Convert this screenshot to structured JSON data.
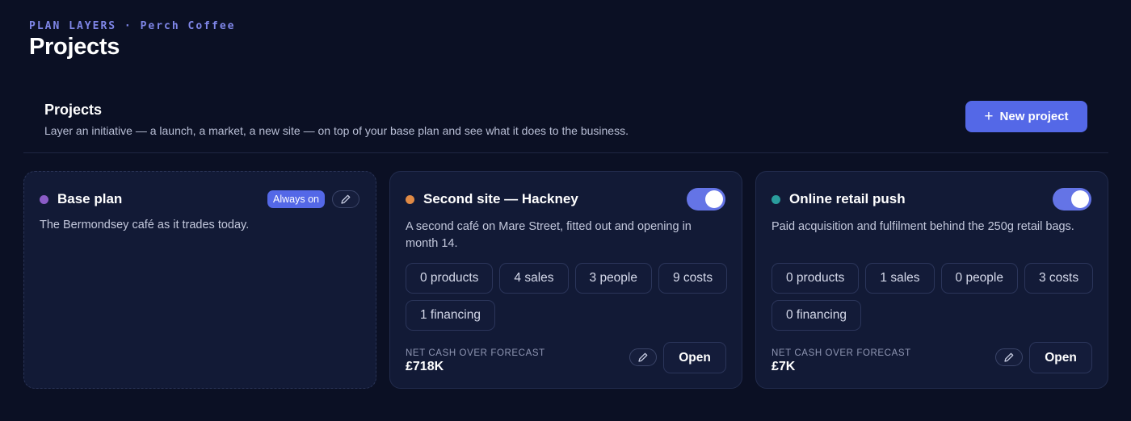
{
  "header": {
    "eyebrow": "PLAN LAYERS · Perch Coffee",
    "title": "Projects"
  },
  "section": {
    "title": "Projects",
    "description": "Layer an initiative — a launch, a market, a new site — on top of your base plan and see what it does to the business.",
    "new_button_label": "New project",
    "new_button_icon": "plus-icon"
  },
  "colors": {
    "background": "#0b1024",
    "accent": "#5468e7",
    "base_dot": "#8b5cc7",
    "second_site_dot": "#e08a45",
    "online_retail_dot": "#2a9d9d"
  },
  "base_card": {
    "title": "Base plan",
    "badge": "Always on",
    "description": "The Bermondsey café as it trades today.",
    "edit_icon": "pencil-icon"
  },
  "projects": [
    {
      "title": "Second site — Hackney",
      "enabled": true,
      "description": "A second café on Mare Street, fitted out and opening in month 14.",
      "chips": [
        "0 products",
        "4 sales",
        "3 people",
        "9 costs",
        "1 financing"
      ],
      "net_label": "NET CASH OVER FORECAST",
      "net_value": "£718K",
      "open_label": "Open"
    },
    {
      "title": "Online retail push",
      "enabled": true,
      "description": "Paid acquisition and fulfilment behind the 250g retail bags.",
      "chips": [
        "0 products",
        "1 sales",
        "0 people",
        "3 costs",
        "0 financing"
      ],
      "net_label": "NET CASH OVER FORECAST",
      "net_value": "£7K",
      "open_label": "Open"
    }
  ]
}
